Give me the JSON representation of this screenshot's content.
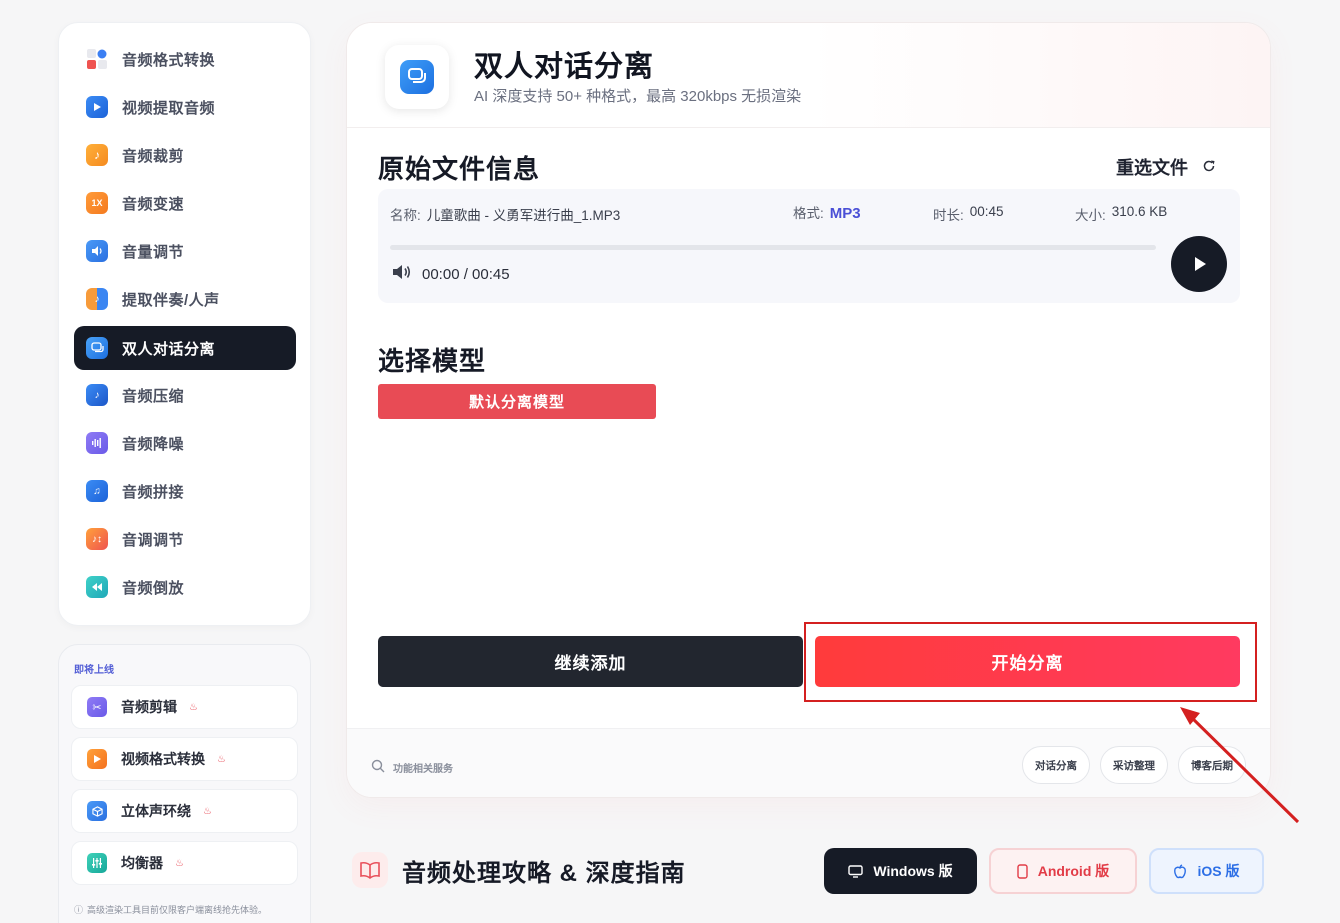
{
  "sidebar": {
    "items": [
      {
        "label": "音频格式转换",
        "icon": "format-convert-icon"
      },
      {
        "label": "视频提取音频",
        "icon": "video-extract-icon"
      },
      {
        "label": "音频裁剪",
        "icon": "audio-cut-icon"
      },
      {
        "label": "音频变速",
        "icon": "speed-icon",
        "glyph": "1X"
      },
      {
        "label": "音量调节",
        "icon": "volume-icon"
      },
      {
        "label": "提取伴奏/人声",
        "icon": "vocal-extract-icon"
      },
      {
        "label": "双人对话分离",
        "icon": "dialogue-icon",
        "active": true
      },
      {
        "label": "音频压缩",
        "icon": "compress-icon"
      },
      {
        "label": "音频降噪",
        "icon": "denoise-icon"
      },
      {
        "label": "音频拼接",
        "icon": "merge-icon"
      },
      {
        "label": "音调调节",
        "icon": "pitch-icon"
      },
      {
        "label": "音频倒放",
        "icon": "reverse-icon"
      }
    ]
  },
  "upcoming": {
    "title": "即将上线",
    "items": [
      {
        "label": "音频剪辑",
        "icon": "scissors-icon"
      },
      {
        "label": "视频格式转换",
        "icon": "video-play-icon"
      },
      {
        "label": "立体声环绕",
        "icon": "cube-icon"
      },
      {
        "label": "均衡器",
        "icon": "equalizer-icon"
      }
    ],
    "note": "高级渲染工具目前仅限客户端离线抢先体验。"
  },
  "header": {
    "title": "双人对话分离",
    "subtitle": "AI 深度支持 50+ 种格式，最高 320kbps 无损渲染"
  },
  "file_info": {
    "section_title": "原始文件信息",
    "reselect_label": "重选文件",
    "name_label": "名称:",
    "name_value": "儿童歌曲 - 义勇军进行曲_1.MP3",
    "format_label": "格式:",
    "format_value": "MP3",
    "duration_label": "时长:",
    "duration_value": "00:45",
    "size_label": "大小:",
    "size_value": "310.6 KB",
    "time_display": "00:00 / 00:45",
    "progress": 0
  },
  "model": {
    "section_title": "选择模型",
    "selected": "默认分离模型"
  },
  "actions": {
    "add_label": "继续添加",
    "start_label": "开始分离"
  },
  "footer": {
    "search_label": "功能相关服务",
    "chips": [
      "对话分离",
      "采访整理",
      "博客后期"
    ]
  },
  "guide": {
    "title": "音频处理攻略 & 深度指南"
  },
  "downloads": {
    "windows": "Windows 版",
    "android": "Android 版",
    "ios": "iOS 版"
  },
  "colors": {
    "accent": "#e84b55",
    "start_gradient_from": "#ff3b3b",
    "start_gradient_to": "#ff3a60",
    "dark": "#161b26",
    "highlight": "#d42020"
  }
}
